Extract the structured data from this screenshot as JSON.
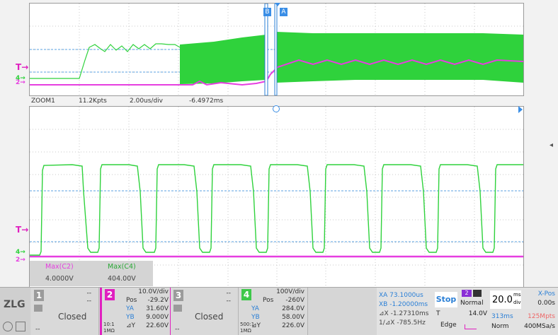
{
  "colors": {
    "ch2": "#e63ee0",
    "ch4": "#2fd23c",
    "trigger": "#e020c0",
    "blue": "#2a7fd6",
    "accent_blue": "#1e90ff"
  },
  "top_view": {
    "marker_b": "B",
    "marker_a": "A",
    "trigger_label": "T",
    "ch4_label": "4",
    "ch2_label": "2"
  },
  "zoom_bar": {
    "name": "ZOOM1",
    "points": "11.2Kpts",
    "timebase": "2.00us/div",
    "offset": "-6.4972ms"
  },
  "main_view": {
    "trigger_label": "T",
    "ch4_label": "4",
    "ch2_label": "2",
    "right_icon": "◂"
  },
  "measurements": {
    "h1": "Max(C2)",
    "h2": "Max(C4)",
    "v1": "4.0000V",
    "v2": "404.00V"
  },
  "bottom": {
    "logo": "ZLG",
    "ch1": {
      "num": "1",
      "dash1": "--",
      "dash2": "--",
      "state": "Closed",
      "footer": "--"
    },
    "ch2": {
      "num": "2",
      "scale": "10.0V/div",
      "pos_label": "Pos",
      "pos_val": "-29.2V",
      "ya_label": "YA",
      "ya_val": "31.60V",
      "yb_label": "YB",
      "yb_val": "9.000V",
      "dy_label": "⊿Y",
      "dy_val": "22.60V",
      "imp": "1MΩ",
      "bw": "10:1"
    },
    "ch3": {
      "num": "3",
      "dash1": "--",
      "dash2": "--",
      "state": "Closed",
      "footer": "--"
    },
    "ch4": {
      "num": "4",
      "scale": "100V/div",
      "pos_label": "Pos",
      "pos_val": "-260V",
      "ya_label": "YA",
      "ya_val": "284.0V",
      "yb_label": "YB",
      "yb_val": "58.00V",
      "dy_label": "⊿Y",
      "dy_val": "226.0V",
      "imp": "1MΩ",
      "bw": "500:1"
    },
    "cursor": {
      "xa": "XA  73.1000us",
      "xb": "XB -1.20000ms",
      "dx": "⊿X -1.27310ms",
      "inv": "1/⊿X  -785.5Hz"
    },
    "run": {
      "stop": "Stop",
      "mode": "Normal",
      "trig_src": "2",
      "trig_label": "T",
      "trig_level": "14.0V",
      "trig_type": "Edge"
    },
    "timebase": {
      "value": "20.0",
      "unit_top": "ms",
      "unit_bot": "div",
      "time_len": "313ms",
      "sample_mpts": "125Mpts",
      "xpos_label": "X-Pos",
      "xpos_val": "0.00s",
      "acq": "Norm",
      "rate": "400MSa/s"
    }
  }
}
